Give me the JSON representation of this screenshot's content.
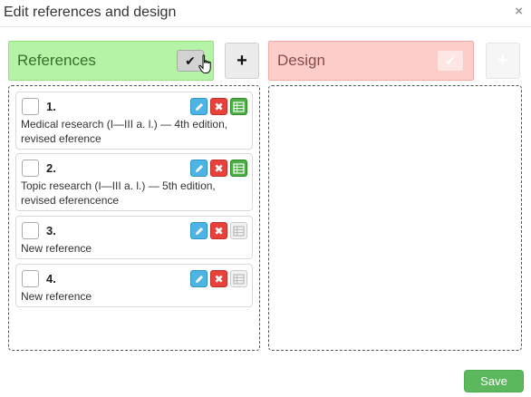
{
  "dialog": {
    "title": "Edit references and design",
    "close_glyph": "×"
  },
  "references": {
    "label": "References",
    "check_glyph": "✔",
    "add_glyph": "+",
    "items": [
      {
        "number": "1.",
        "text": "Medical research (I—III a. l.) — 4th edition, revised eference",
        "table_enabled": true
      },
      {
        "number": "2.",
        "text": "Topic research (I—III a. l.) — 5th edition, revised eferencence",
        "table_enabled": true
      },
      {
        "number": "3.",
        "text": "New reference",
        "table_enabled": false
      },
      {
        "number": "4.",
        "text": "New reference",
        "table_enabled": false
      }
    ]
  },
  "design": {
    "label": "Design",
    "check_glyph": "✔",
    "add_glyph": "+"
  },
  "footer": {
    "save_label": "Save"
  },
  "icons": {
    "edit": "pencil-icon",
    "delete": "x-icon",
    "table": "table-icon",
    "cursor": "hand-pointer-icon"
  },
  "colors": {
    "references_bg": "#b5f4a6",
    "design_bg": "#fdcdc9",
    "save": "#5cb85c",
    "edit": "#4db4e4",
    "delete": "#e8413c",
    "table_on": "#4caf46"
  }
}
